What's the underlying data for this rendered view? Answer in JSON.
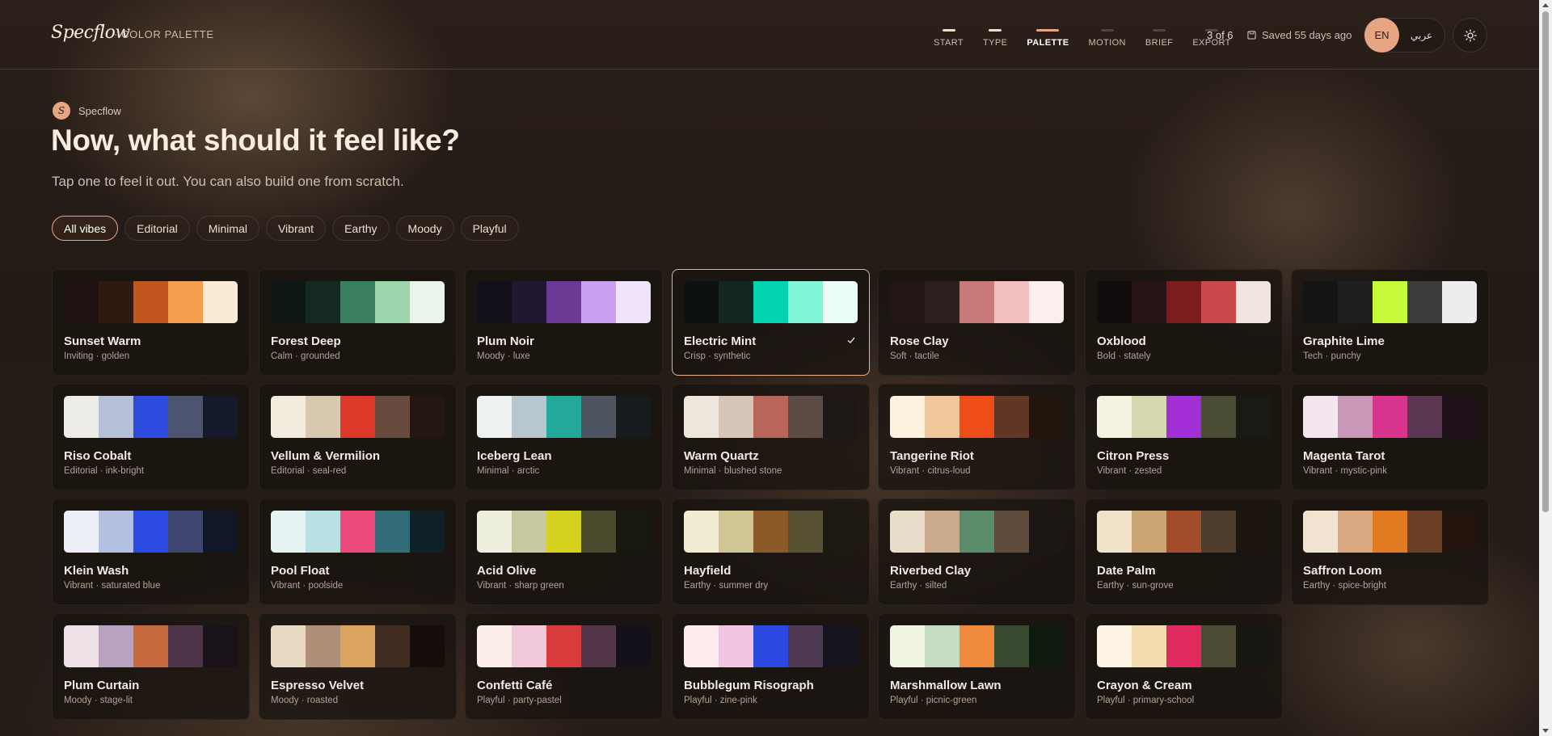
{
  "header": {
    "logo": "Specflow",
    "section": "· COLOR PALETTE",
    "steps": [
      {
        "label": "START",
        "state": "done"
      },
      {
        "label": "TYPE",
        "state": "done"
      },
      {
        "label": "PALETTE",
        "state": "active"
      },
      {
        "label": "MOTION",
        "state": "todo"
      },
      {
        "label": "BRIEF",
        "state": "todo"
      },
      {
        "label": "EXPORT",
        "state": "todo"
      }
    ],
    "progress": "3 of 6",
    "saved": "Saved 55 days ago",
    "lang_en": "EN",
    "lang_ar": "عربي"
  },
  "intro": {
    "brand_initial": "S",
    "brand_name": "Specflow",
    "title": "Now, what should it feel like?",
    "subtitle": "Tap one to feel it out. You can also build one from scratch."
  },
  "filters": [
    "All vibes",
    "Editorial",
    "Minimal",
    "Vibrant",
    "Earthy",
    "Moody",
    "Playful"
  ],
  "active_filter": "All vibes",
  "palettes": [
    {
      "name": "Sunset Warm",
      "desc": "Inviting · golden",
      "colors": [
        "#1e1210",
        "#2f1a12",
        "#c1571e",
        "#f39d4d",
        "#fbebd6"
      ]
    },
    {
      "name": "Forest Deep",
      "desc": "Calm · grounded",
      "colors": [
        "#0f1714",
        "#14291f",
        "#3a7f5f",
        "#9dd4ab",
        "#eaf3ec"
      ]
    },
    {
      "name": "Plum Noir",
      "desc": "Moody · luxe",
      "colors": [
        "#120e1a",
        "#201830",
        "#6a3a94",
        "#c9a0ef",
        "#efe4fa"
      ]
    },
    {
      "name": "Electric Mint",
      "desc": "Crisp · synthetic",
      "colors": [
        "#0b1210",
        "#142620",
        "#00d3ae",
        "#7ff7d6",
        "#ebfcf7"
      ],
      "selected": true
    },
    {
      "name": "Rose Clay",
      "desc": "Soft · tactile",
      "colors": [
        "#211516",
        "#2e1f1f",
        "#c77a79",
        "#f1bfbd",
        "#fbeeee"
      ]
    },
    {
      "name": "Oxblood",
      "desc": "Bold · stately",
      "colors": [
        "#130c0c",
        "#281415",
        "#7b1c1e",
        "#c9494b",
        "#f2e4df"
      ]
    },
    {
      "name": "Graphite Lime",
      "desc": "Tech · punchy",
      "colors": [
        "#141414",
        "#1f1f1f",
        "#c5f93a",
        "#3b3b3b",
        "#ededed"
      ]
    },
    {
      "name": "Riso Cobalt",
      "desc": "Editorial · ink-bright",
      "colors": [
        "#edece6",
        "#b5c0d8",
        "#2e4be0",
        "#4c5470",
        "#141a2b"
      ]
    },
    {
      "name": "Vellum & Vermilion",
      "desc": "Editorial · seal-red",
      "colors": [
        "#f3ebdd",
        "#d9c8b0",
        "#dd392b",
        "#674c3e",
        "#241612"
      ]
    },
    {
      "name": "Iceberg Lean",
      "desc": "Minimal · arctic",
      "colors": [
        "#eef1f2",
        "#b8c6ce",
        "#24a89a",
        "#4d5660",
        "#161b1f"
      ]
    },
    {
      "name": "Warm Quartz",
      "desc": "Minimal · blushed stone",
      "colors": [
        "#efe6de",
        "#d7c6b8",
        "#b9665a",
        "#5b4b44",
        "#1d1715"
      ]
    },
    {
      "name": "Tangerine Riot",
      "desc": "Vibrant · citrus-loud",
      "colors": [
        "#fdf1e0",
        "#efc79a",
        "#ee4c19",
        "#603624",
        "#20140d"
      ]
    },
    {
      "name": "Citron Press",
      "desc": "Vibrant · zested",
      "colors": [
        "#f4f1e0",
        "#d6d8b0",
        "#a22ed6",
        "#4a4b35",
        "#191a14"
      ]
    },
    {
      "name": "Magenta Tarot",
      "desc": "Vibrant · mystic-pink",
      "colors": [
        "#f3e6ef",
        "#c898b6",
        "#d9358f",
        "#5a3650",
        "#1e1019"
      ]
    },
    {
      "name": "Klein Wash",
      "desc": "Vibrant · saturated blue",
      "colors": [
        "#eceff6",
        "#b4c0e0",
        "#2b4be3",
        "#3f4670",
        "#121728"
      ]
    },
    {
      "name": "Pool Float",
      "desc": "Vibrant · poolside",
      "colors": [
        "#e5f3f2",
        "#b8e0e3",
        "#ed4a7c",
        "#326d77",
        "#0f2127"
      ]
    },
    {
      "name": "Acid Olive",
      "desc": "Vibrant · sharp green",
      "colors": [
        "#eeefdf",
        "#c8c9a0",
        "#d5d11f",
        "#4a4a2c",
        "#17180f"
      ]
    },
    {
      "name": "Hayfield",
      "desc": "Earthy · summer dry",
      "colors": [
        "#f1ecd2",
        "#cfc694",
        "#8c5a29",
        "#575032",
        "#1c1a10"
      ]
    },
    {
      "name": "Riverbed Clay",
      "desc": "Earthy · silted",
      "colors": [
        "#e8ddc9",
        "#c9ab8b",
        "#5a8b6b",
        "#5e4b3b",
        "#1c1714"
      ]
    },
    {
      "name": "Date Palm",
      "desc": "Earthy · sun-grove",
      "colors": [
        "#f0e3c9",
        "#c8a572",
        "#a34d2c",
        "#4e3d2c",
        "#1b150d"
      ]
    },
    {
      "name": "Saffron Loom",
      "desc": "Earthy · spice-bright",
      "colors": [
        "#f2e3d0",
        "#daa881",
        "#e17b22",
        "#6a3f26",
        "#22140d"
      ]
    },
    {
      "name": "Plum Curtain",
      "desc": "Moody · stage-lit",
      "colors": [
        "#ede0e6",
        "#b9a2c0",
        "#c66a3d",
        "#4d3449",
        "#1a1219"
      ]
    },
    {
      "name": "Espresso Velvet",
      "desc": "Moody · roasted",
      "colors": [
        "#e9dac6",
        "#b08f78",
        "#dca25f",
        "#422c21",
        "#140d09"
      ]
    },
    {
      "name": "Confetti Café",
      "desc": "Playful · party-pastel",
      "colors": [
        "#fbeeea",
        "#f0c9dc",
        "#d93a3c",
        "#533649",
        "#14101a"
      ]
    },
    {
      "name": "Bubblegum Risograph",
      "desc": "Playful · zine-pink",
      "colors": [
        "#fbebed",
        "#f2c4e2",
        "#2b4ae0",
        "#4e3a52",
        "#16141f"
      ]
    },
    {
      "name": "Marshmallow Lawn",
      "desc": "Playful · picnic-green",
      "colors": [
        "#eef3e2",
        "#c4dcbf",
        "#ee8a3a",
        "#384b30",
        "#0f1a0f"
      ]
    },
    {
      "name": "Crayon & Cream",
      "desc": "Playful · primary-school",
      "colors": [
        "#fdf3e3",
        "#f2dcae",
        "#df2a5d",
        "#4c4a35",
        "#171712"
      ]
    }
  ]
}
